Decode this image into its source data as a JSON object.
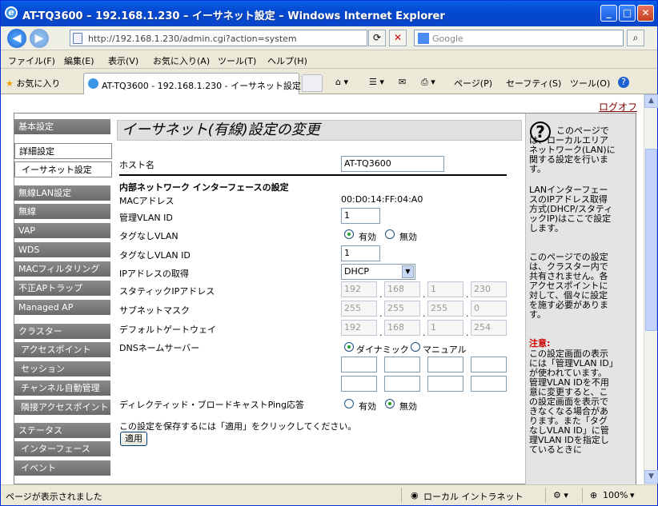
{
  "browser": {
    "title": "AT-TQ3600 – 192.168.1.230 – イーサネット設定 – Windows Internet Explorer",
    "url": "http://192.168.1.230/admin.cgi?action=system",
    "search_placeholder": "Google",
    "tab_title": "AT-TQ3600 - 192.168.1.230 - イーサネット設定",
    "favorites_label": "お気に入り",
    "win_min": "_",
    "win_max": "□",
    "win_close": "✕"
  },
  "menu": [
    "ファイル(F)",
    "編集(E)",
    "表示(V)",
    "お気に入り(A)",
    "ツール(T)",
    "ヘルプ(H)"
  ],
  "toolbar": {
    "page": "ページ(P)",
    "safety": "セーフティ(S)",
    "tools": "ツール(O)",
    "help": "?"
  },
  "status": {
    "text": "ページが表示されました",
    "zone": "ローカル イントラネット",
    "zoom": "100%"
  },
  "logout": "ログオフ",
  "nav": {
    "basic": "基本設定",
    "advanced": "詳細設定",
    "ethernet": "イーサネット設定",
    "wlan": "無線LAN設定",
    "wireless": "無線",
    "vap": "VAP",
    "wds": "WDS",
    "mac_filter": "MACフィルタリング",
    "rogue": "不正APトラップ",
    "managed": "Managed AP",
    "cluster": "クラスター",
    "cluster_ap": "アクセスポイント",
    "session": "セッション",
    "channel": "チャンネル自動管理",
    "neighbor": "隣接アクセスポイント",
    "status": "ステータス",
    "interface": "インターフェース",
    "event": "イベント"
  },
  "form": {
    "title": "イーサネット(有線)設定の変更",
    "hostname_label": "ホスト名",
    "hostname": "AT-TQ3600",
    "section": "内部ネットワーク インターフェースの設定",
    "mac_label": "MACアドレス",
    "mac": "00:D0:14:FF:04:A0",
    "mgmt_vlan_label": "管理VLAN ID",
    "mgmt_vlan": "1",
    "untagged_label": "タグなしVLAN",
    "enabled": "有効",
    "disabled": "無効",
    "untagged_id_label": "タグなしVLAN ID",
    "untagged_id": "1",
    "ip_mode_label": "IPアドレスの取得",
    "ip_mode": "DHCP",
    "static_ip_label": "スタティックIPアドレス",
    "ip": [
      "192",
      "168",
      "1",
      "230"
    ],
    "mask_label": "サブネットマスク",
    "mask": [
      "255",
      "255",
      "255",
      "0"
    ],
    "gw_label": "デフォルトゲートウェイ",
    "gw": [
      "192",
      "168",
      "1",
      "254"
    ],
    "dns_label": "DNSネームサーバー",
    "dns_dynamic": "ダイナミック",
    "dns_manual": "マニュアル",
    "bcast_label": "ディレクティッド・ブロードキャストPing応答",
    "save_note": "この設定を保存するには「適用」をクリックしてください。",
    "apply": "適用"
  },
  "help": {
    "intro": "このページでは、ローカルエリアネットワーク(LAN)に関する設定を行います。",
    "p2": "LANインターフェースのIPアドレス取得方式(DHCP/スタティックIP)はここで設定します。",
    "p3": "このページでの設定は、クラスター内で共有されません。各アクセスポイントに対して、個々に設定を施す必要があります。",
    "caution": "注意:",
    "p4": "この設定画面の表示には「管理VLAN ID」が使われています。管理VLAN IDを不用意に変更すると、この設定画面を表示できなくなる場合があります。また「タグなしVLAN ID」に管理VLAN IDを指定しているときに"
  }
}
